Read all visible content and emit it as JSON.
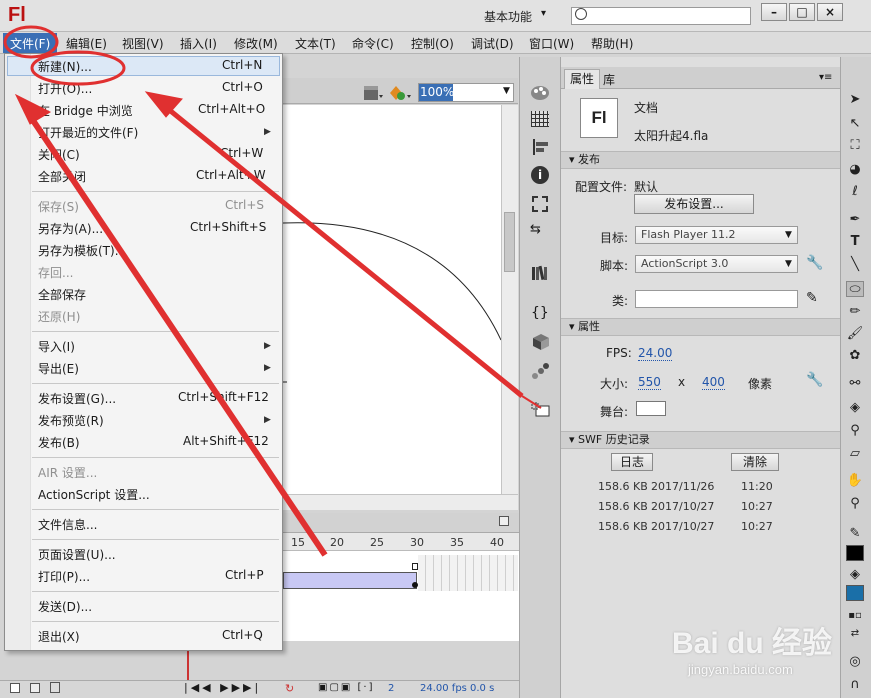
{
  "app": {
    "logo": "Fl",
    "workspace": "基本功能",
    "window_buttons": [
      "–",
      "□",
      "×"
    ]
  },
  "menubar": [
    "文件(F)",
    "编辑(E)",
    "视图(V)",
    "插入(I)",
    "修改(M)",
    "文本(T)",
    "命令(C)",
    "控制(O)",
    "调试(D)",
    "窗口(W)",
    "帮助(H)"
  ],
  "file_menu": [
    {
      "label": "新建(N)...",
      "shortcut": "Ctrl+N",
      "disabled": false
    },
    {
      "label": "打开(O)...",
      "shortcut": "Ctrl+O",
      "disabled": false
    },
    {
      "label": "在 Bridge 中浏览",
      "shortcut": "Ctrl+Alt+O",
      "disabled": false
    },
    {
      "label": "打开最近的文件(F)",
      "shortcut": "",
      "submenu": true
    },
    {
      "label": "关闭(C)",
      "shortcut": "Ctrl+W"
    },
    {
      "label": "全部关闭",
      "shortcut": "Ctrl+Alt+W"
    },
    {
      "label": "保存(S)",
      "shortcut": "Ctrl+S",
      "disabled": true
    },
    {
      "label": "另存为(A)...",
      "shortcut": "Ctrl+Shift+S"
    },
    {
      "label": "另存为模板(T)...",
      "shortcut": ""
    },
    {
      "label": "存回...",
      "shortcut": "",
      "disabled": true
    },
    {
      "label": "全部保存",
      "shortcut": ""
    },
    {
      "label": "还原(H)",
      "shortcut": "",
      "disabled": true
    },
    {
      "label": "导入(I)",
      "shortcut": "",
      "submenu": true
    },
    {
      "label": "导出(E)",
      "shortcut": "",
      "submenu": true
    },
    {
      "label": "发布设置(G)...",
      "shortcut": "Ctrl+Shift+F12"
    },
    {
      "label": "发布预览(R)",
      "shortcut": "",
      "submenu": true
    },
    {
      "label": "发布(B)",
      "shortcut": "Alt+Shift+F12"
    },
    {
      "label": "AIR 设置...",
      "shortcut": "",
      "disabled": true
    },
    {
      "label": "ActionScript 设置...",
      "shortcut": ""
    },
    {
      "label": "文件信息...",
      "shortcut": ""
    },
    {
      "label": "页面设置(U)...",
      "shortcut": ""
    },
    {
      "label": "打印(P)...",
      "shortcut": "Ctrl+P"
    },
    {
      "label": "发送(D)...",
      "shortcut": ""
    },
    {
      "label": "退出(X)",
      "shortcut": "Ctrl+Q"
    }
  ],
  "stage": {
    "zoom": "100%"
  },
  "timeline": {
    "frame_numbers": [
      "15",
      "20",
      "25",
      "30",
      "35",
      "40"
    ],
    "current_frame": "2",
    "fps": "24.00 fps",
    "time": "0.0 s"
  },
  "properties": {
    "tab_props": "属性",
    "tab_library": "库",
    "doc_icon": "Fl",
    "doc_type": "文档",
    "doc_name": "太阳升起4.fla",
    "publish_section": "发布",
    "profile_label": "配置文件:",
    "profile_value": "默认",
    "publish_settings_btn": "发布设置...",
    "target_label": "目标:",
    "target_value": "Flash Player 11.2",
    "script_label": "脚本:",
    "script_value": "ActionScript 3.0",
    "class_label": "类:",
    "props_section": "属性",
    "fps_label": "FPS:",
    "fps_value": "24.00",
    "size_label": "大小:",
    "width": "550",
    "x_sep": "x",
    "height": "400",
    "unit": "像素",
    "stage_label": "舞台:",
    "swf_section": "SWF 历史记录",
    "log_btn": "日志",
    "clear_btn": "清除",
    "history": [
      {
        "size": "158.6 KB",
        "date": "2017/11/26",
        "time": "11:20"
      },
      {
        "size": "158.6 KB",
        "date": "2017/10/27",
        "time": "10:27"
      },
      {
        "size": "158.6 KB",
        "date": "2017/10/27",
        "time": "10:27"
      }
    ]
  },
  "watermark": {
    "brand": "Bai du 经验",
    "url": "jingyan.baidu.com"
  },
  "colors": {
    "menu_highlight": "#3a6fb5",
    "annotation": "#e03030",
    "tl_span": "#c8c8f4",
    "fill_swatch": "#1a6fa8"
  }
}
